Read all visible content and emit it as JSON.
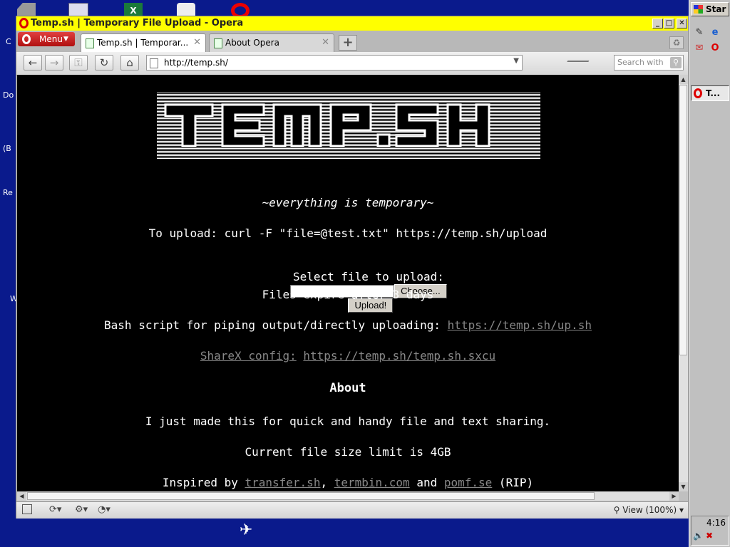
{
  "desktop": {
    "labels": [
      "C",
      "Do",
      "(B",
      "Re",
      "W"
    ]
  },
  "taskbar": {
    "start_label": "Star",
    "task_label": "T...",
    "clock": "4:16"
  },
  "window": {
    "title": "Temp.sh | Temporary File Upload - Opera",
    "menu_label": "Menu",
    "tabs": [
      {
        "label": "Temp.sh | Temporar..."
      },
      {
        "label": "About Opera"
      }
    ],
    "address": "http://temp.sh/",
    "search_placeholder": "Search with",
    "zoom_label": "View (100%)"
  },
  "page": {
    "logo_text": "TEMP.SH",
    "tagline": "~everything is temporary~",
    "upload_cmd": "To upload: curl -F \"file=@test.txt\" https://temp.sh/upload",
    "select_label": "Select file to upload:",
    "choose_label": "Choose...",
    "upload_label": "Upload!",
    "expire": "Files expire after 3 days",
    "bash_label": "Bash script for piping output/directly uploading: ",
    "bash_link": "https://temp.sh/up.sh",
    "sharex_link_label": "ShareX config:",
    "sharex_link": "https://temp.sh/temp.sh.sxcu",
    "about_heading": "About",
    "about_text": "I just made this for quick and handy file and text sharing.",
    "size_limit": "Current file size limit is 4GB",
    "inspired_prefix": "Inspired by ",
    "inspired_link1": "transfer.sh",
    "inspired_sep1": ", ",
    "inspired_link2": "termbin.com",
    "inspired_sep2": " and ",
    "inspired_link3": "pomf.se",
    "inspired_suffix": " (RIP)"
  }
}
